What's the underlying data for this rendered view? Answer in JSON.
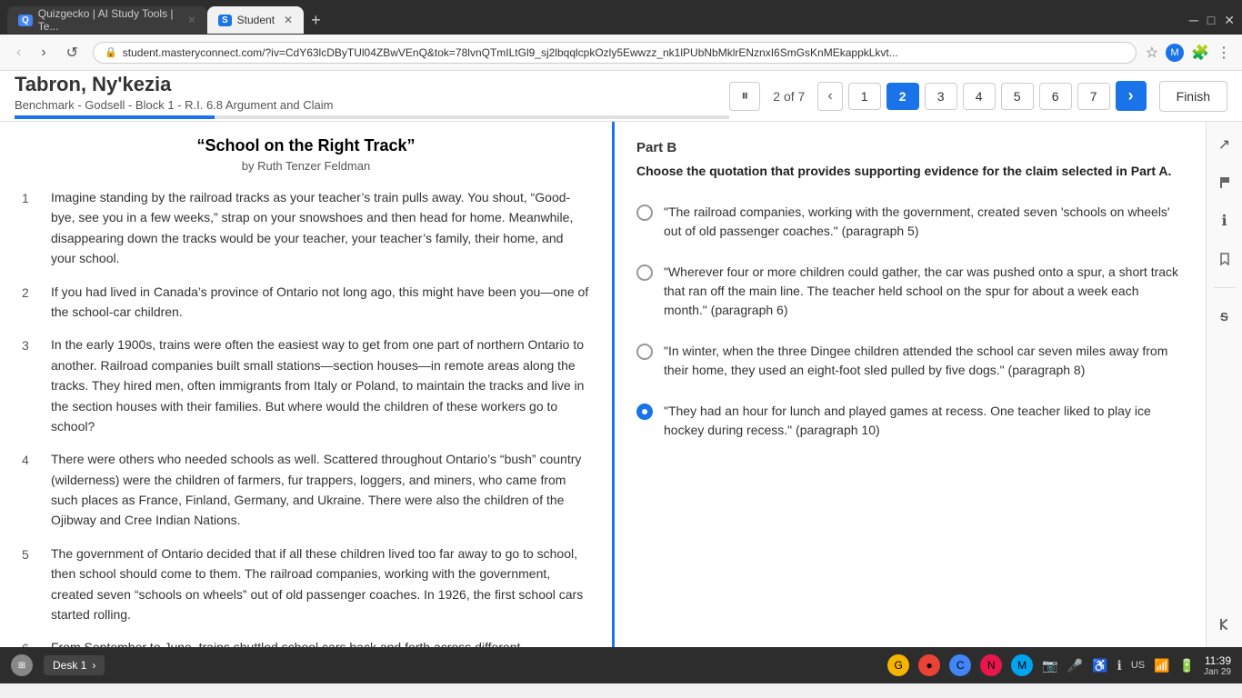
{
  "browser": {
    "tabs": [
      {
        "label": "Quizgecko | AI Study Tools | Te...",
        "active": false,
        "favicon": "Q"
      },
      {
        "label": "Student",
        "active": true,
        "favicon": "S"
      }
    ],
    "url": "student.masteryconnect.com/?iv=CdY63lcDByTUl04ZBwVEnQ&tok=78lvnQTmILtGl9_sj2lbqqlcpkOzly5Ewwzz_nk1lPUbNbMklrENznxI6SmGsKnMEkappkLkvt...",
    "add_tab": "+"
  },
  "header": {
    "student_name": "Tabron, Ny'kezia",
    "benchmark": "Benchmark - Godsell - Block 1 - R.I. 6.8 Argument and Claim",
    "question_count": "2 of 7",
    "pause_icon": "⏸",
    "prev_icon": "‹",
    "next_icon": "›",
    "next_arrow": "›",
    "finish_label": "Finish",
    "pages": [
      "1",
      "2",
      "3",
      "4",
      "5",
      "6",
      "7"
    ],
    "current_page": 2,
    "progress_percent": 28
  },
  "passage": {
    "title": "“School on the Right Track”",
    "author": "by Ruth Tenzer Feldman",
    "paragraphs": [
      {
        "num": "1",
        "text": "Imagine standing by the railroad tracks as your teacher’s train pulls away. You shout, “Good-bye, see you in a few weeks,” strap on your snowshoes and then head for home. Meanwhile, disappearing down the tracks would be your teacher, your teacher’s family, their home, and your school."
      },
      {
        "num": "2",
        "text": "If you had lived in Canada’s province of Ontario not long ago, this might have been you—one of the school-car children."
      },
      {
        "num": "3",
        "text": "In the early 1900s, trains were often the easiest way to get from one part of northern Ontario to another. Railroad companies built small stations—section houses—in remote areas along the tracks. They hired men, often immigrants from Italy or Poland, to maintain the tracks and live in the section houses with their families. But where would the children of these workers go to school?"
      },
      {
        "num": "4",
        "text": "There were others who needed schools as well. Scattered throughout Ontario’s “bush” country (wilderness) were the children of farmers, fur trappers, loggers, and miners, who came from such places as France, Finland, Germany, and Ukraine. There were also the children of the Ojibway and Cree Indian Nations."
      },
      {
        "num": "5",
        "text": "The government of Ontario decided that if all these children lived too far away to go to school, then school should come to them. The railroad companies, working with the government, created seven “schools on wheels” out of old passenger coaches. In 1926, the first school cars started rolling."
      },
      {
        "num": "6",
        "text": "From September to June, trains shuttled school cars back and forth across different"
      }
    ]
  },
  "question": {
    "part_label": "Part B",
    "question_text": "Choose the quotation that provides supporting evidence for the claim selected in Part A.",
    "options": [
      {
        "id": "A",
        "text": "\"The railroad companies, working with the government, created seven 'schools on wheels' out of old passenger coaches.\" (paragraph 5)",
        "selected": false
      },
      {
        "id": "B",
        "text": "\"Wherever four or more children could gather, the car was pushed onto a spur, a short track that ran off the main line. The teacher held school on the spur for about a week each month.\" (paragraph 6)",
        "selected": false
      },
      {
        "id": "C",
        "text": "\"In winter, when the three Dingee children attended the school car seven miles away from their home, they used an eight-foot sled pulled by five dogs.\" (paragraph 8)",
        "selected": false
      },
      {
        "id": "D",
        "text": "\"They had an hour for lunch and played games at recess. One teacher liked to play ice hockey during recess.\" (paragraph 10)",
        "selected": true
      }
    ]
  },
  "toolbar": {
    "icons": [
      {
        "name": "expand-icon",
        "glyph": "↗"
      },
      {
        "name": "flag-icon",
        "glyph": "⚑"
      },
      {
        "name": "info-icon",
        "glyph": "ℹ"
      },
      {
        "name": "bookmark-icon",
        "glyph": "⚐"
      },
      {
        "name": "strikethrough-icon",
        "glyph": "S̶"
      },
      {
        "name": "back-icon",
        "glyph": "←"
      }
    ]
  },
  "taskbar": {
    "desk_label": "Desk 1",
    "chevron": "›",
    "time": "11:39",
    "date": "Jan 29",
    "locale": "US"
  }
}
